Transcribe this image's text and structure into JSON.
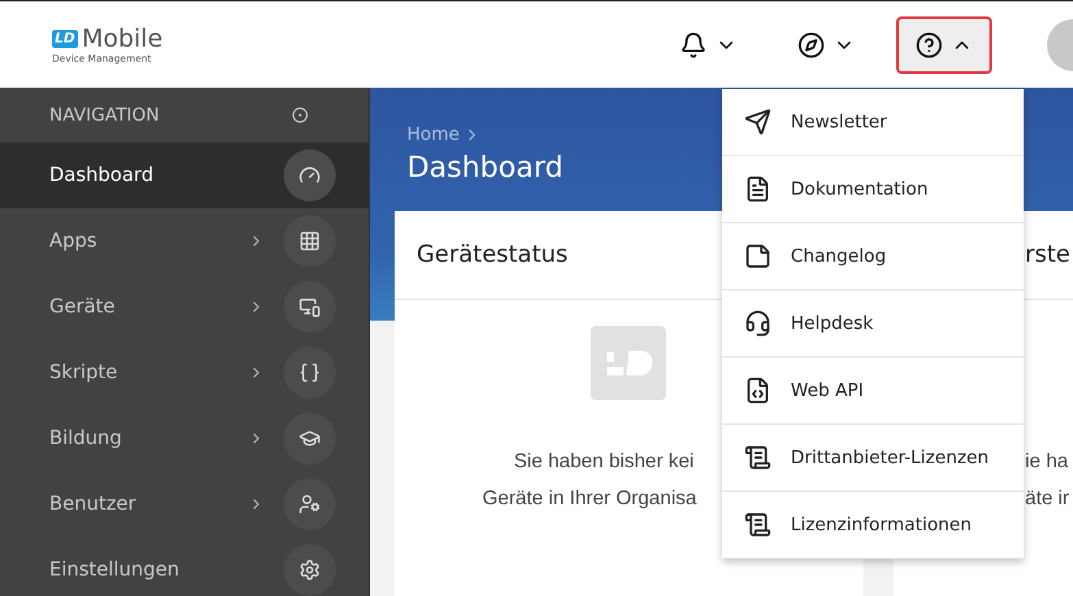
{
  "header": {
    "logo": {
      "badge": "LD",
      "title": "Mobile",
      "subtitle": "Device Management"
    },
    "buttons": [
      {
        "kind": "bell",
        "expanded": false
      },
      {
        "kind": "compass",
        "expanded": false
      },
      {
        "kind": "help",
        "expanded": true
      }
    ]
  },
  "sidebar": {
    "heading": "NAVIGATION",
    "items": [
      {
        "label": "Dashboard",
        "selected": true,
        "expandable": false
      },
      {
        "label": "Apps",
        "selected": false,
        "expandable": true
      },
      {
        "label": "Geräte",
        "selected": false,
        "expandable": true
      },
      {
        "label": "Skripte",
        "selected": false,
        "expandable": true
      },
      {
        "label": "Bildung",
        "selected": false,
        "expandable": true
      },
      {
        "label": "Benutzer",
        "selected": false,
        "expandable": true
      },
      {
        "label": "Einstellungen",
        "selected": false,
        "expandable": false
      }
    ]
  },
  "breadcrumb": [
    "Home"
  ],
  "page_title": "Dashboard",
  "cards": [
    {
      "title": "Gerätestatus",
      "lines": [
        "Sie haben bisher kei",
        "Geräte in Ihrer Organisa"
      ]
    },
    {
      "title": "rste",
      "lines": [
        "ie ha",
        "äte ir"
      ]
    }
  ],
  "help_menu": [
    "Newsletter",
    "Dokumentation",
    "Changelog",
    "Helpdesk",
    "Web API",
    "Drittanbieter-Lizenzen",
    "Lizenzinformationen"
  ]
}
